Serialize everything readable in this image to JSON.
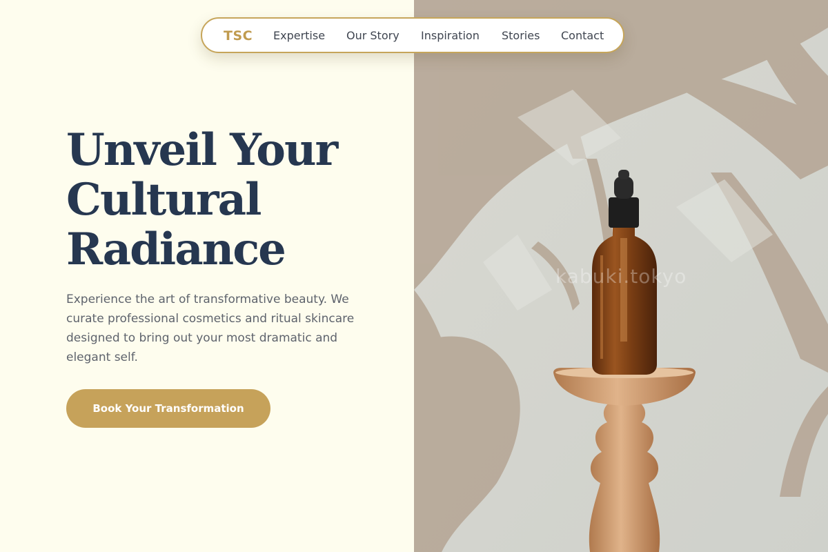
{
  "nav": {
    "logo": "TSC",
    "links": [
      "Expertise",
      "Our Story",
      "Inspiration",
      "Stories",
      "Contact"
    ]
  },
  "hero": {
    "headline_lines": [
      "Unveil Your",
      "Cultural",
      "Radiance"
    ],
    "description": "Experience the art of transformative beauty. We curate professional cosmetics and ritual skincare designed to bring out your most dramatic and elegant self.",
    "cta_label": "Book Your Transformation"
  },
  "image": {
    "watermark": "kabuki.tokyo",
    "subject": "amber-dropper-bottle-on-wooden-pedestal"
  },
  "colors": {
    "background": "#fefdee",
    "accent_gold": "#c6a25a",
    "headline_navy": "#263750",
    "body_gray": "#5e636c"
  }
}
